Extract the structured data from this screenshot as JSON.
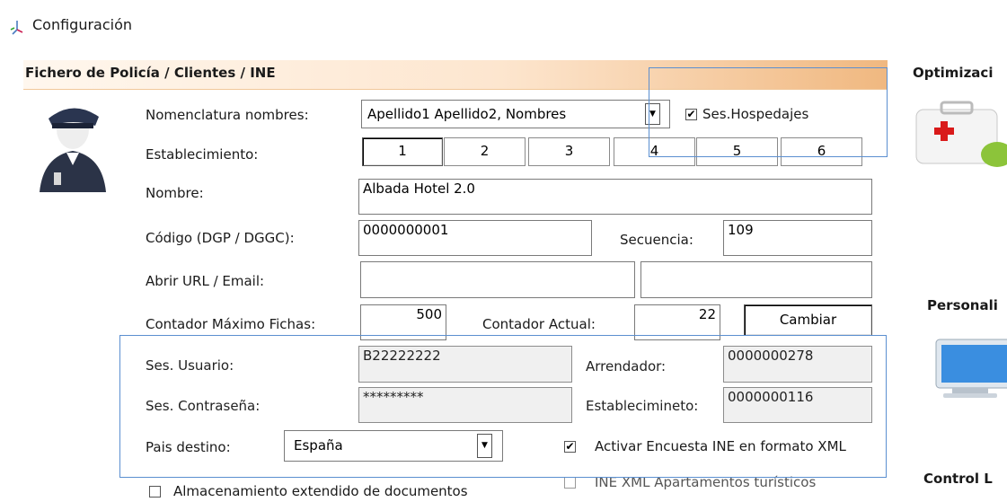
{
  "window": {
    "title": "Configuración",
    "icon": "settings-app-icon"
  },
  "section": {
    "title": "Fichero de Policía / Clientes / INE",
    "icon": "police-officer-icon"
  },
  "right_panel": {
    "optimizacion_label": "Optimizaci",
    "personali_label": "Personali",
    "control_label": "Control L"
  },
  "form": {
    "nomenclatura_label": "Nomenclatura nombres:",
    "nomenclatura_value": "Apellido1 Apellido2, Nombres",
    "ses_hospedajes_label": "Ses.Hospedajes",
    "ses_hospedajes_checked": true,
    "establecimiento_label": "Establecimiento:",
    "establecimiento_buttons": [
      "1",
      "2",
      "3",
      "4",
      "5",
      "6"
    ],
    "nombre_label": "Nombre:",
    "nombre_value": "Albada Hotel 2.0",
    "codigo_label": "Código (DGP / DGGC):",
    "codigo_value": "0000000001",
    "secuencia_label": "Secuencia:",
    "secuencia_value": "109",
    "abrir_url_label": "Abrir URL / Email:",
    "abrir_url_value1": "",
    "abrir_url_value2": "",
    "contador_max_label": "Contador Máximo Fichas:",
    "contador_max_value": "500",
    "contador_actual_label": "Contador Actual:",
    "contador_actual_value": "22",
    "cambiar_label": "Cambiar",
    "ses_usuario_label": "Ses. Usuario:",
    "ses_usuario_value": "B22222222",
    "arrendador_label": "Arrendador:",
    "arrendador_value": "0000000278",
    "ses_contrasena_label": "Ses. Contraseña:",
    "ses_contrasena_value": "*********",
    "establecimineto_label": "Establecimineto:",
    "establecimineto_value": "0000000116",
    "pais_label": "Pais destino:",
    "pais_value": "España",
    "activar_encuesta_label": "Activar Encuesta INE en formato XML",
    "activar_encuesta_checked": true,
    "ine_xml_label": "INE XML Apartamentos turísticos",
    "ine_xml_checked": false,
    "almacenamiento_label": "Almacenamiento extendido de documentos",
    "almacenamiento_checked": false
  },
  "colors": {
    "header_gradient_end": "#f0b880",
    "highlight_border": "#5b8fd0"
  }
}
